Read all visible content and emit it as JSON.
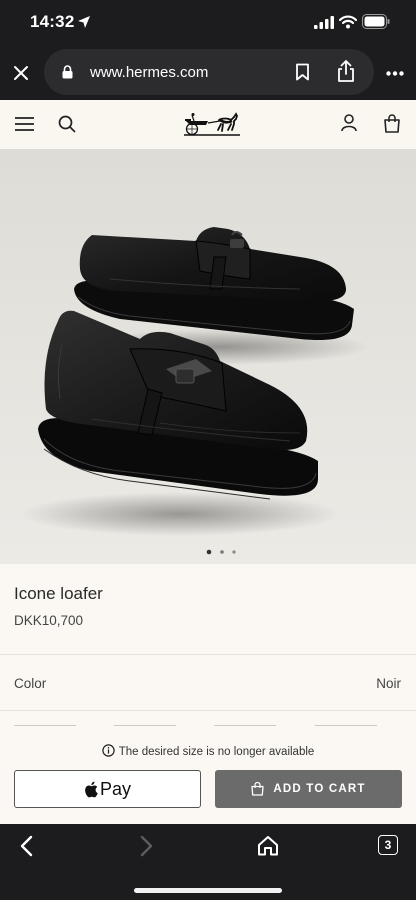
{
  "status_bar": {
    "time": "14:32"
  },
  "browser": {
    "url": "www.hermes.com",
    "tab_count": "3"
  },
  "product": {
    "name": "Icone loafer",
    "price": "DKK10,700",
    "color_label": "Color",
    "color_value": "Noir",
    "size_notice": "The desired size is no longer available",
    "apple_pay_label": "Pay",
    "add_to_cart_label": "ADD TO CART",
    "image_dots": 3,
    "active_dot": 1
  }
}
